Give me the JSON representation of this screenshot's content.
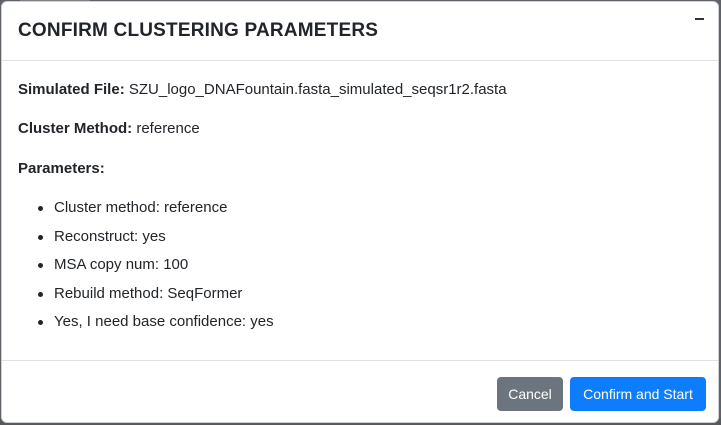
{
  "modal": {
    "title": "CONFIRM CLUSTERING PARAMETERS",
    "close_icon": "minimize-dash-icon",
    "simulated_file_label": "Simulated File:",
    "simulated_file_value": "SZU_logo_DNAFountain.fasta_simulated_seqsr1r2.fasta",
    "cluster_method_label": "Cluster Method:",
    "cluster_method_value": "reference",
    "parameters_label": "Parameters:",
    "parameters": [
      "Cluster method: reference",
      "Reconstruct: yes",
      "MSA copy num: 100",
      "Rebuild method: SeqFormer",
      "Yes, I need base confidence: yes"
    ],
    "cancel_label": "Cancel",
    "confirm_label": "Confirm and Start"
  },
  "colors": {
    "cancel_button": "#6c757d",
    "confirm_button": "#0d7dfd",
    "backdrop": "#5f6267"
  }
}
